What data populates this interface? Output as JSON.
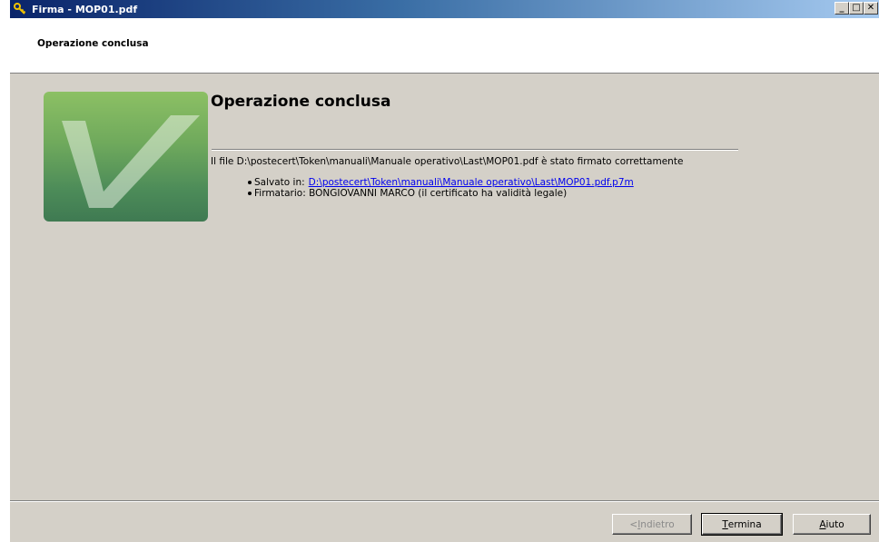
{
  "window": {
    "title": "Firma - MOP01.pdf",
    "controls": {
      "minimize": "_",
      "maximize": "□",
      "close": "✕"
    }
  },
  "header": {
    "title": "Operazione conclusa"
  },
  "main": {
    "title": "Operazione conclusa",
    "message": "Il file D:\\postecert\\Token\\manuali\\Manuale operativo\\Last\\MOP01.pdf è stato firmato correttamente",
    "details": [
      {
        "label": "Salvato in:",
        "link": "D:\\postecert\\Token\\manuali\\Manuale operativo\\Last\\MOP01.pdf.p7m"
      },
      {
        "label": "Firmatario: BONGIOVANNI MARCO (il certificato ha validità legale)"
      }
    ]
  },
  "buttons": {
    "back": {
      "prefix": "< ",
      "accel": "I",
      "rest": "ndietro",
      "enabled": false
    },
    "finish": {
      "accel": "T",
      "rest": "ermina",
      "enabled": true,
      "default": true
    },
    "help": {
      "accel": "A",
      "rest": "iuto",
      "enabled": true
    }
  },
  "icons": {
    "app": "key-icon",
    "logo": "checkmark-icon"
  },
  "colors": {
    "logo_top": "#8cc064",
    "logo_bottom": "#3f7a52",
    "link": "#0000ee",
    "titlebar_start": "#0a246a"
  }
}
